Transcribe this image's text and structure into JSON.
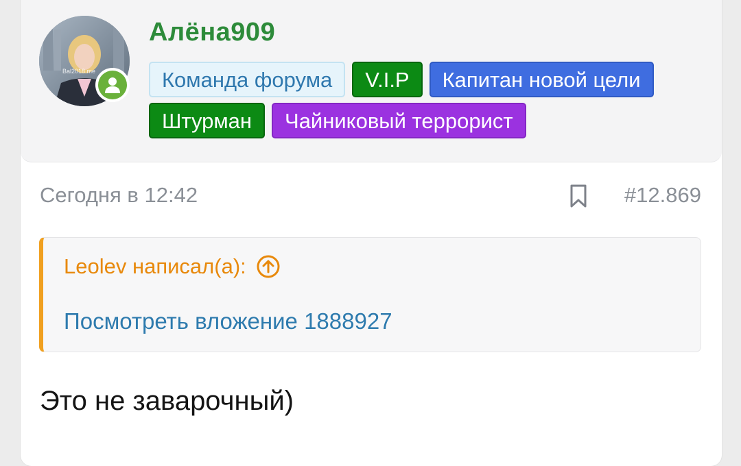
{
  "user": {
    "name": "Алёна909",
    "avatar_watermark": "Bal2018.me",
    "online": true,
    "badges": [
      {
        "label": "Команда форума"
      },
      {
        "label": "V.I.P"
      },
      {
        "label": "Капитан новой цели"
      },
      {
        "label": "Штурман"
      },
      {
        "label": "Чайниковый террорист"
      }
    ]
  },
  "post": {
    "date": "Сегодня в 12:42",
    "number": "#12.869",
    "quote": {
      "author": "Leolev написал(а):",
      "link": "Посмотреть вложение 1888927"
    },
    "message": "Это не заварочный)"
  },
  "colors": {
    "username": "#2d8b3a",
    "vip": "#0c8a14",
    "captain": "#3f6de0",
    "teapot": "#9b32e0",
    "team_bg": "#e6f4fb",
    "quote_accent": "#f0a020",
    "link": "#2e7bae",
    "online": "#6ab13b"
  },
  "icons": {
    "online": "user-icon",
    "bookmark": "bookmark-icon",
    "quote_jump": "arrow-up-circle-icon"
  }
}
